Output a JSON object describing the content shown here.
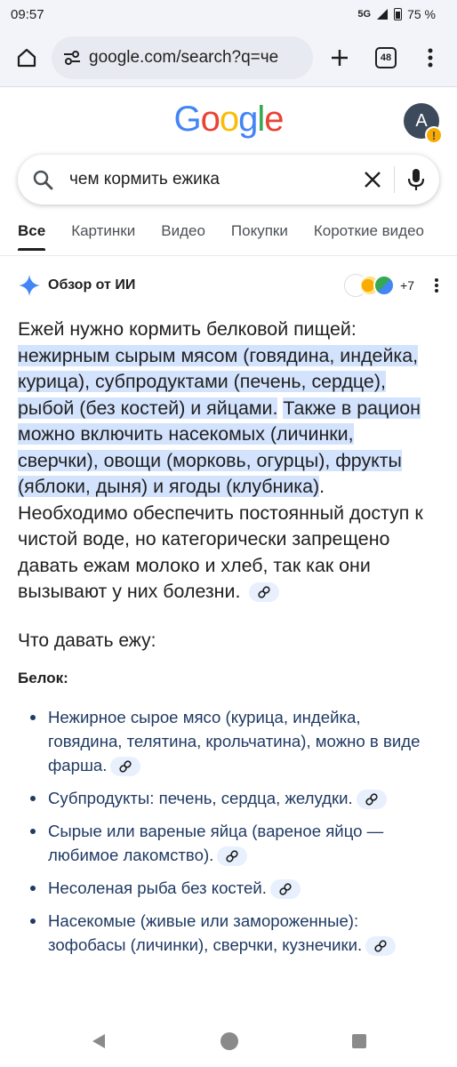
{
  "status": {
    "time": "09:57",
    "network": "5G",
    "battery": "75 %"
  },
  "browser": {
    "url": "google.com/search?q=че",
    "tab_count": "48"
  },
  "google": {
    "logo": "Google",
    "avatar_letter": "A",
    "avatar_badge": "!"
  },
  "search": {
    "query": "чем кормить ежика"
  },
  "tabs": [
    {
      "label": "Все",
      "active": true
    },
    {
      "label": "Картинки"
    },
    {
      "label": "Видео"
    },
    {
      "label": "Покупки"
    },
    {
      "label": "Короткие видео"
    }
  ],
  "ai_overview": {
    "title": "Обзор от ИИ",
    "sources_more": "+7",
    "intro": "Ежей нужно кормить белковой пищей:",
    "highlight_1": "нежирным сырым мясом (говядина, индейка, курица), субпродуктами (печень, сердце), рыбой (без костей) и яйцами.",
    "highlight_2": "Также в рацион можно включить насекомых (личинки, сверчки), овощи (морковь, огурцы), фрукты (яблоки, дыня) и ягоды (клубника)",
    "rest": ". Необходимо обеспечить постоянный доступ к чистой воде, но категорически запрещено давать ежам молоко и хлеб, так как они вызывают у них болезни.",
    "section_title": "Что давать ежу:",
    "subhead": "Белок:",
    "items": [
      "Нежирное сырое мясо (курица, индейка, говядина, телятина, крольчатина), можно в виде фарша.",
      "Субпродукты: печень, сердца, желудки.",
      "Сырые или вареные яйца (вареное яйцо — любимое лакомство).",
      "Несоленая рыба без костей.",
      "Насекомые (живые или замороженные): зофобасы (личинки), сверчки, кузнечики."
    ]
  },
  "colors": {
    "highlight": "#d3e3fd",
    "accent_blue": "#4285f4",
    "list_text": "#1f3a63"
  }
}
